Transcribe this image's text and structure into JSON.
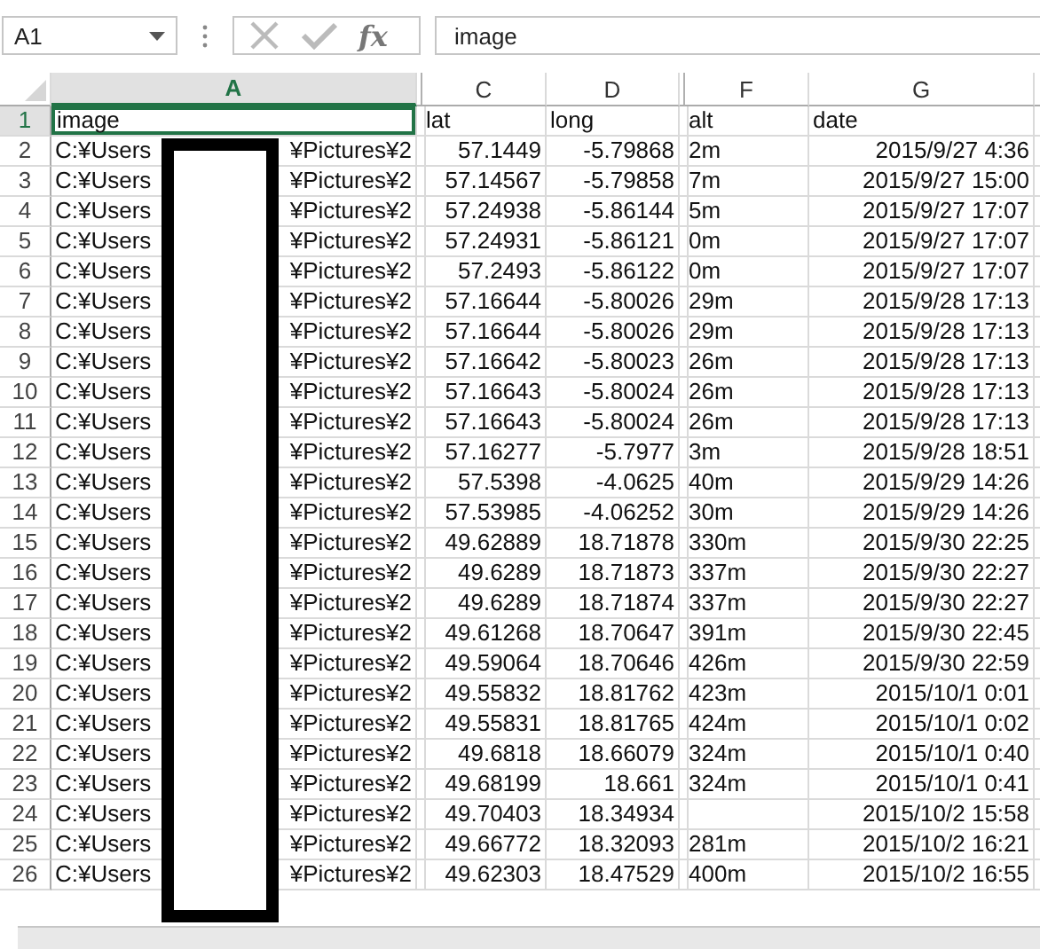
{
  "name_box": {
    "value": "A1"
  },
  "formula_bar": {
    "function_label": "fx",
    "value": "image"
  },
  "columns": [
    {
      "label": "A",
      "selected": true
    },
    {
      "label": "C",
      "selected": false
    },
    {
      "label": "D",
      "selected": false
    },
    {
      "label": "F",
      "selected": false
    },
    {
      "label": "G",
      "selected": false
    }
  ],
  "rows": [
    {
      "number": "1",
      "kind": "header",
      "selected": true,
      "cells": [
        "image",
        "lat",
        "long",
        "alt",
        "date"
      ]
    },
    {
      "number": "2",
      "kind": "data",
      "selected": false,
      "cells": [
        {
          "prefix": "C:¥Users",
          "suffix": "¥Pictures¥2"
        },
        "57.1449",
        "-5.79868",
        "2m",
        "2015/9/27 4:36"
      ]
    },
    {
      "number": "3",
      "kind": "data",
      "selected": false,
      "cells": [
        {
          "prefix": "C:¥Users",
          "suffix": "¥Pictures¥2"
        },
        "57.14567",
        "-5.79858",
        "7m",
        "2015/9/27 15:00"
      ]
    },
    {
      "number": "4",
      "kind": "data",
      "selected": false,
      "cells": [
        {
          "prefix": "C:¥Users",
          "suffix": "¥Pictures¥2"
        },
        "57.24938",
        "-5.86144",
        "5m",
        "2015/9/27 17:07"
      ]
    },
    {
      "number": "5",
      "kind": "data",
      "selected": false,
      "cells": [
        {
          "prefix": "C:¥Users",
          "suffix": "¥Pictures¥2"
        },
        "57.24931",
        "-5.86121",
        "0m",
        "2015/9/27 17:07"
      ]
    },
    {
      "number": "6",
      "kind": "data",
      "selected": false,
      "cells": [
        {
          "prefix": "C:¥Users",
          "suffix": "¥Pictures¥2"
        },
        "57.2493",
        "-5.86122",
        "0m",
        "2015/9/27 17:07"
      ]
    },
    {
      "number": "7",
      "kind": "data",
      "selected": false,
      "cells": [
        {
          "prefix": "C:¥Users",
          "suffix": "¥Pictures¥2"
        },
        "57.16644",
        "-5.80026",
        "29m",
        "2015/9/28 17:13"
      ]
    },
    {
      "number": "8",
      "kind": "data",
      "selected": false,
      "cells": [
        {
          "prefix": "C:¥Users",
          "suffix": "¥Pictures¥2"
        },
        "57.16644",
        "-5.80026",
        "29m",
        "2015/9/28 17:13"
      ]
    },
    {
      "number": "9",
      "kind": "data",
      "selected": false,
      "cells": [
        {
          "prefix": "C:¥Users",
          "suffix": "¥Pictures¥2"
        },
        "57.16642",
        "-5.80023",
        "26m",
        "2015/9/28 17:13"
      ]
    },
    {
      "number": "10",
      "kind": "data",
      "selected": false,
      "cells": [
        {
          "prefix": "C:¥Users",
          "suffix": "¥Pictures¥2"
        },
        "57.16643",
        "-5.80024",
        "26m",
        "2015/9/28 17:13"
      ]
    },
    {
      "number": "11",
      "kind": "data",
      "selected": false,
      "cells": [
        {
          "prefix": "C:¥Users",
          "suffix": "¥Pictures¥2"
        },
        "57.16643",
        "-5.80024",
        "26m",
        "2015/9/28 17:13"
      ]
    },
    {
      "number": "12",
      "kind": "data",
      "selected": false,
      "cells": [
        {
          "prefix": "C:¥Users",
          "suffix": "¥Pictures¥2"
        },
        "57.16277",
        "-5.7977",
        "3m",
        "2015/9/28 18:51"
      ]
    },
    {
      "number": "13",
      "kind": "data",
      "selected": false,
      "cells": [
        {
          "prefix": "C:¥Users",
          "suffix": "¥Pictures¥2"
        },
        "57.5398",
        "-4.0625",
        "40m",
        "2015/9/29 14:26"
      ]
    },
    {
      "number": "14",
      "kind": "data",
      "selected": false,
      "cells": [
        {
          "prefix": "C:¥Users",
          "suffix": "¥Pictures¥2"
        },
        "57.53985",
        "-4.06252",
        "30m",
        "2015/9/29 14:26"
      ]
    },
    {
      "number": "15",
      "kind": "data",
      "selected": false,
      "cells": [
        {
          "prefix": "C:¥Users",
          "suffix": "¥Pictures¥2"
        },
        "49.62889",
        "18.71878",
        "330m",
        "2015/9/30 22:25"
      ]
    },
    {
      "number": "16",
      "kind": "data",
      "selected": false,
      "cells": [
        {
          "prefix": "C:¥Users",
          "suffix": "¥Pictures¥2"
        },
        "49.6289",
        "18.71873",
        "337m",
        "2015/9/30 22:27"
      ]
    },
    {
      "number": "17",
      "kind": "data",
      "selected": false,
      "cells": [
        {
          "prefix": "C:¥Users",
          "suffix": "¥Pictures¥2"
        },
        "49.6289",
        "18.71874",
        "337m",
        "2015/9/30 22:27"
      ]
    },
    {
      "number": "18",
      "kind": "data",
      "selected": false,
      "cells": [
        {
          "prefix": "C:¥Users",
          "suffix": "¥Pictures¥2"
        },
        "49.61268",
        "18.70647",
        "391m",
        "2015/9/30 22:45"
      ]
    },
    {
      "number": "19",
      "kind": "data",
      "selected": false,
      "cells": [
        {
          "prefix": "C:¥Users",
          "suffix": "¥Pictures¥2"
        },
        "49.59064",
        "18.70646",
        "426m",
        "2015/9/30 22:59"
      ]
    },
    {
      "number": "20",
      "kind": "data",
      "selected": false,
      "cells": [
        {
          "prefix": "C:¥Users",
          "suffix": "¥Pictures¥2"
        },
        "49.55832",
        "18.81762",
        "423m",
        "2015/10/1 0:01"
      ]
    },
    {
      "number": "21",
      "kind": "data",
      "selected": false,
      "cells": [
        {
          "prefix": "C:¥Users",
          "suffix": "¥Pictures¥2"
        },
        "49.55831",
        "18.81765",
        "424m",
        "2015/10/1 0:02"
      ]
    },
    {
      "number": "22",
      "kind": "data",
      "selected": false,
      "cells": [
        {
          "prefix": "C:¥Users",
          "suffix": "¥Pictures¥2"
        },
        "49.6818",
        "18.66079",
        "324m",
        "2015/10/1 0:40"
      ]
    },
    {
      "number": "23",
      "kind": "data",
      "selected": false,
      "cells": [
        {
          "prefix": "C:¥Users",
          "suffix": "¥Pictures¥2"
        },
        "49.68199",
        "18.661",
        "324m",
        "2015/10/1 0:41"
      ]
    },
    {
      "number": "24",
      "kind": "data",
      "selected": false,
      "cells": [
        {
          "prefix": "C:¥Users",
          "suffix": "¥Pictures¥2"
        },
        "49.70403",
        "18.34934",
        null,
        "2015/10/2 15:58"
      ]
    },
    {
      "number": "25",
      "kind": "data",
      "selected": false,
      "cells": [
        {
          "prefix": "C:¥Users",
          "suffix": "¥Pictures¥2"
        },
        "49.66772",
        "18.32093",
        "281m",
        "2015/10/2 16:21"
      ]
    },
    {
      "number": "26",
      "kind": "data",
      "selected": false,
      "cells": [
        {
          "prefix": "C:¥Users",
          "suffix": "¥Pictures¥2"
        },
        "49.62303",
        "18.47529",
        "400m",
        "2015/10/2 16:55"
      ]
    }
  ]
}
